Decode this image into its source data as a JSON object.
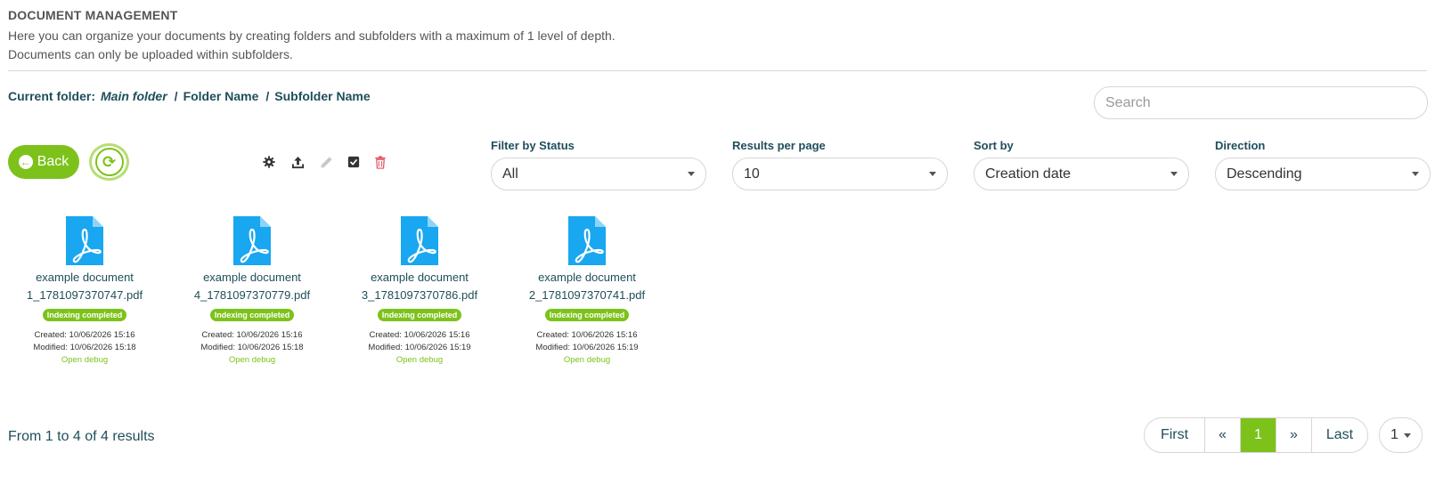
{
  "header": {
    "title": "DOCUMENT MANAGEMENT",
    "desc_line1": "Here you can organize your documents by creating folders and subfolders with a maximum of 1 level of depth.",
    "desc_line2": "Documents can only be uploaded within subfolders."
  },
  "breadcrumb": {
    "prefix": "Current folder:",
    "main": "Main folder",
    "sep1": "/",
    "folder": "Folder Name",
    "sep2": "/",
    "subfolder": "Subfolder Name"
  },
  "search": {
    "placeholder": "Search",
    "value": ""
  },
  "toolbar": {
    "back_label": "Back",
    "icons": [
      "gear-icon",
      "upload-icon",
      "pencil-icon",
      "check-square-icon",
      "trash-icon"
    ]
  },
  "filters": {
    "status": {
      "label": "Filter by Status",
      "value": "All"
    },
    "results": {
      "label": "Results per page",
      "value": "10"
    },
    "sort": {
      "label": "Sort by",
      "value": "Creation date"
    },
    "direction": {
      "label": "Direction",
      "value": "Descending"
    }
  },
  "documents": [
    {
      "name_line1": "example document",
      "name_line2": "1_1781097370747.pdf",
      "status": "Indexing completed",
      "created": "Created: 10/06/2026 15:16",
      "modified": "Modified: 10/06/2026 15:18",
      "debug": "Open debug"
    },
    {
      "name_line1": "example document",
      "name_line2": "4_1781097370779.pdf",
      "status": "Indexing completed",
      "created": "Created: 10/06/2026 15:16",
      "modified": "Modified: 10/06/2026 15:18",
      "debug": "Open debug"
    },
    {
      "name_line1": "example document",
      "name_line2": "3_1781097370786.pdf",
      "status": "Indexing completed",
      "created": "Created: 10/06/2026 15:16",
      "modified": "Modified: 10/06/2026 15:19",
      "debug": "Open debug"
    },
    {
      "name_line1": "example document",
      "name_line2": "2_1781097370741.pdf",
      "status": "Indexing completed",
      "created": "Created: 10/06/2026 15:16",
      "modified": "Modified: 10/06/2026 15:19",
      "debug": "Open debug"
    }
  ],
  "footer": {
    "results_text": "From 1 to 4 of 4 results",
    "pager": {
      "first": "First",
      "prev": "«",
      "current": "1",
      "next": "»",
      "last": "Last"
    },
    "page_select": "1"
  },
  "colors": {
    "accent": "#7cc21a",
    "pdf_blue": "#18a7f0",
    "danger": "#e05260",
    "text_dark": "#1f4e5a"
  }
}
